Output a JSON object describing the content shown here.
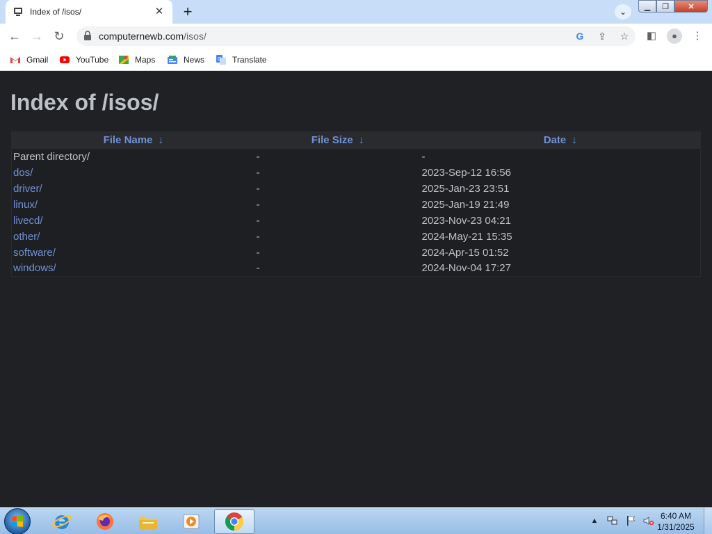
{
  "browser": {
    "tab": {
      "title": "Index of /isos/",
      "favicon": "computer-icon"
    },
    "url": {
      "host": "computernewb.com",
      "path": "/isos/"
    },
    "bookmarks": [
      {
        "label": "Gmail",
        "icon": "gmail-icon"
      },
      {
        "label": "YouTube",
        "icon": "youtube-icon"
      },
      {
        "label": "Maps",
        "icon": "maps-icon"
      },
      {
        "label": "News",
        "icon": "news-icon"
      },
      {
        "label": "Translate",
        "icon": "translate-icon"
      }
    ]
  },
  "page": {
    "title": "Index of /isos/",
    "columns": [
      {
        "label": "File Name",
        "arrow": "↓"
      },
      {
        "label": "File Size",
        "arrow": "↓"
      },
      {
        "label": "Date",
        "arrow": "↓"
      }
    ],
    "rows": [
      {
        "name": "Parent directory/",
        "size": "-",
        "date": "-"
      },
      {
        "name": "dos/",
        "size": "-",
        "date": "2023-Sep-12 16:56"
      },
      {
        "name": "driver/",
        "size": "-",
        "date": "2025-Jan-23 23:51"
      },
      {
        "name": "linux/",
        "size": "-",
        "date": "2025-Jan-19 21:49"
      },
      {
        "name": "livecd/",
        "size": "-",
        "date": "2023-Nov-23 04:21"
      },
      {
        "name": "other/",
        "size": "-",
        "date": "2024-May-21 15:35"
      },
      {
        "name": "software/",
        "size": "-",
        "date": "2024-Apr-15 01:52"
      },
      {
        "name": "windows/",
        "size": "-",
        "date": "2024-Nov-04 17:27"
      }
    ]
  },
  "taskbar": {
    "apps": [
      "internet-explorer-icon",
      "firefox-icon",
      "file-explorer-icon",
      "media-player-icon",
      "chrome-icon"
    ],
    "clock": {
      "time": "6:40 AM",
      "date": "1/31/2025"
    }
  },
  "colors": {
    "link": "#6f92d8",
    "page_bg": "#202124",
    "text": "#bdc1c6",
    "tab_strip": "#c8def8"
  }
}
